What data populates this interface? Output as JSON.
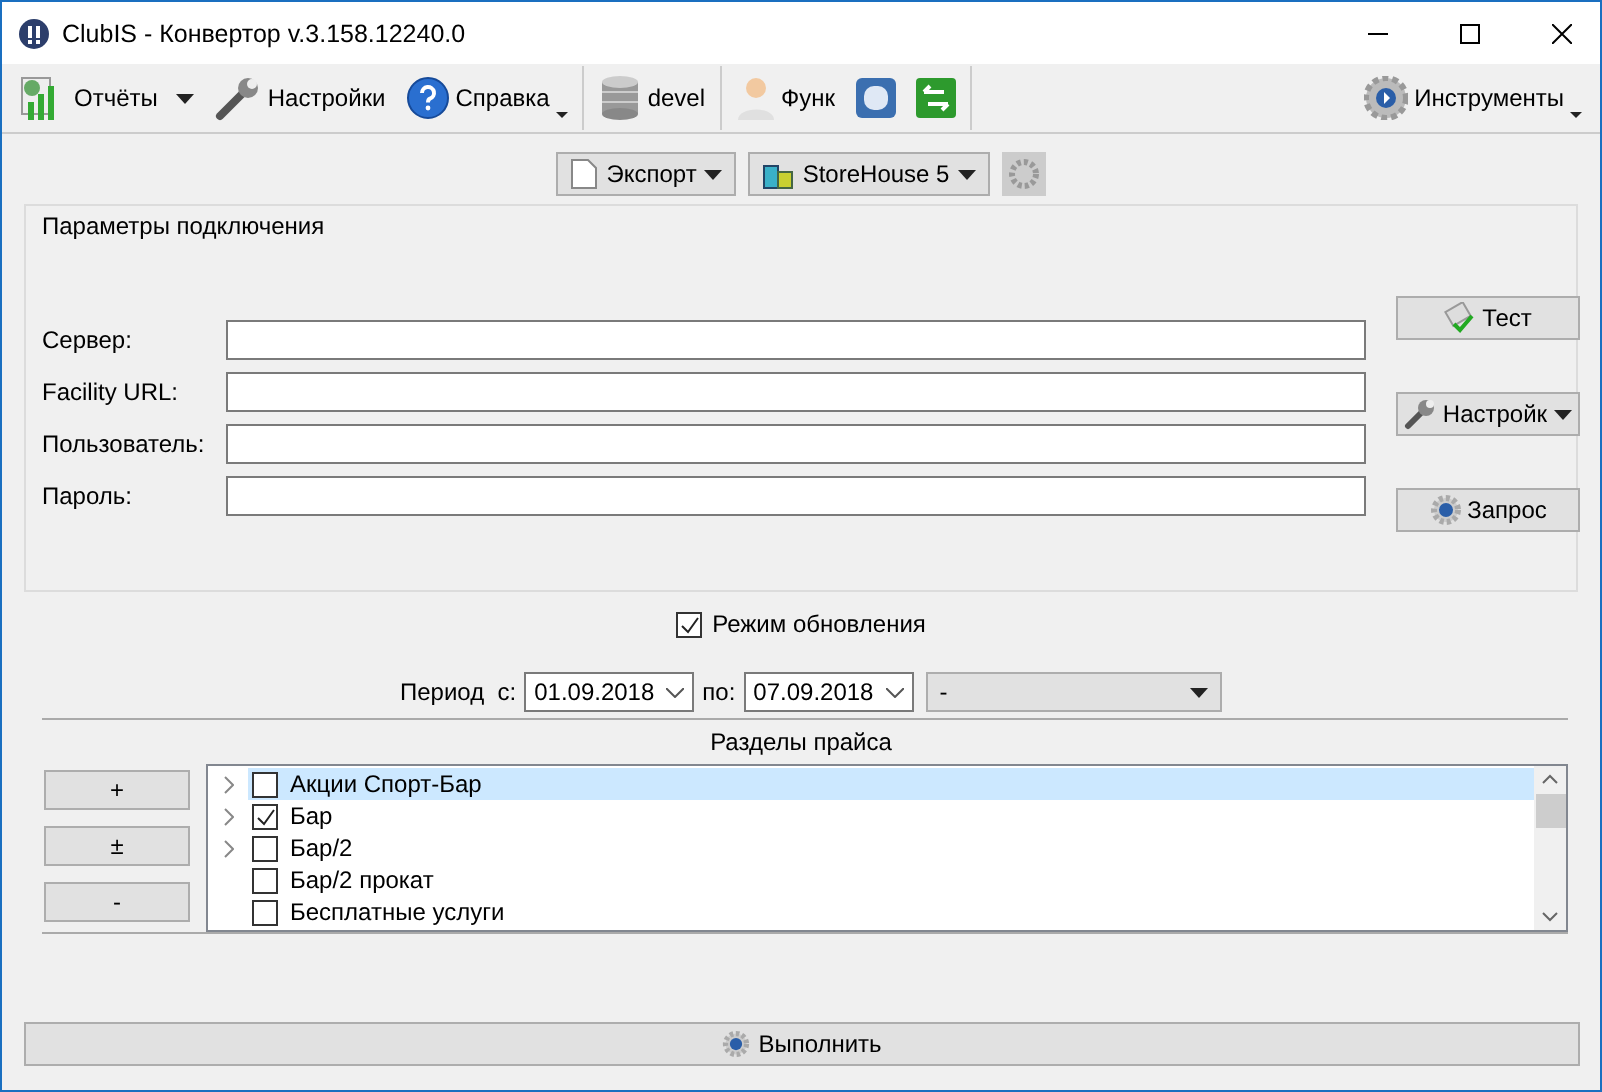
{
  "window": {
    "title": "ClubIS - Конвертор v.3.158.12240.0"
  },
  "toolbar": {
    "items": [
      {
        "kind": "menu",
        "label": "Отчёты"
      },
      {
        "kind": "button",
        "label": "Настройки"
      },
      {
        "kind": "split",
        "label": "Справка"
      },
      {
        "kind": "sep"
      },
      {
        "kind": "button",
        "label": "devel"
      },
      {
        "kind": "sep"
      },
      {
        "kind": "button",
        "label": "Функ"
      },
      {
        "kind": "icon"
      },
      {
        "kind": "icon"
      },
      {
        "kind": "sep"
      }
    ],
    "right": {
      "label": "Инструменты"
    }
  },
  "subbar": {
    "export": "Экспорт",
    "target": "StoreHouse 5"
  },
  "connection": {
    "title": "Параметры подключения",
    "fields": [
      {
        "label": "Сервер:"
      },
      {
        "label": "Facility URL:"
      },
      {
        "label": "Пользователь:"
      },
      {
        "label": "Пароль:"
      }
    ],
    "buttons": [
      {
        "kind": "test",
        "label": "Тест"
      },
      {
        "kind": "menu",
        "label": "Настройк"
      },
      {
        "kind": "gear",
        "label": "Запрос"
      }
    ]
  },
  "update_mode": {
    "label": "Режим обновления",
    "checked": true
  },
  "period": {
    "label": "Период  с:",
    "from": "01.09.2018",
    "to_label": "по:",
    "to": "07.09.2018",
    "preset": "-"
  },
  "sections": {
    "title": "Разделы прайса",
    "buttons": [
      "+",
      "±",
      "-"
    ],
    "items": [
      {
        "label": "Акции Спорт-Бар",
        "expandable": true,
        "checked": false,
        "selected": true
      },
      {
        "label": "Бар",
        "expandable": true,
        "checked": true,
        "selected": false
      },
      {
        "label": "Бар/2",
        "expandable": true,
        "checked": false,
        "selected": false
      },
      {
        "label": "Бар/2 прокат",
        "expandable": false,
        "checked": false,
        "selected": false
      },
      {
        "label": "Бесплатные услуги",
        "expandable": false,
        "checked": false,
        "selected": false
      }
    ]
  },
  "run_button": "Выполнить"
}
